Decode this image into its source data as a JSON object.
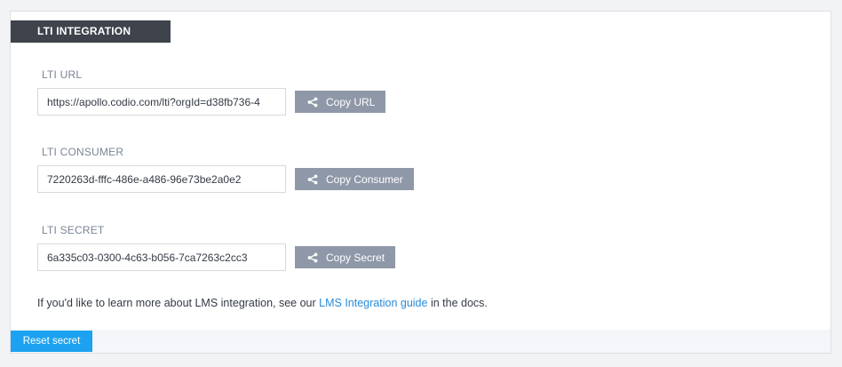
{
  "section": {
    "title": "LTI INTEGRATION"
  },
  "fields": [
    {
      "label": "LTI URL",
      "value": "https://apollo.codio.com/lti?orgId=d38fb736-4",
      "button_label": "Copy URL",
      "button_icon": "share-icon"
    },
    {
      "label": "LTI CONSUMER",
      "value": "7220263d-fffc-486e-a486-96e73be2a0e2",
      "button_label": "Copy Consumer",
      "button_icon": "share-icon"
    },
    {
      "label": "LTI SECRET",
      "value": "6a335c03-0300-4c63-b056-7ca7263c2cc3",
      "button_label": "Copy Secret",
      "button_icon": "share-icon"
    }
  ],
  "info": {
    "prefix": "If you'd like to learn more about LMS integration, see our ",
    "link_text": "LMS Integration guide",
    "suffix": " in the docs."
  },
  "footer": {
    "reset_label": "Reset secret"
  },
  "colors": {
    "tab_bg": "#3e434c",
    "button_bg": "#8f98a8",
    "link": "#2a8bd8",
    "reset_bg": "#1ca2f0"
  }
}
